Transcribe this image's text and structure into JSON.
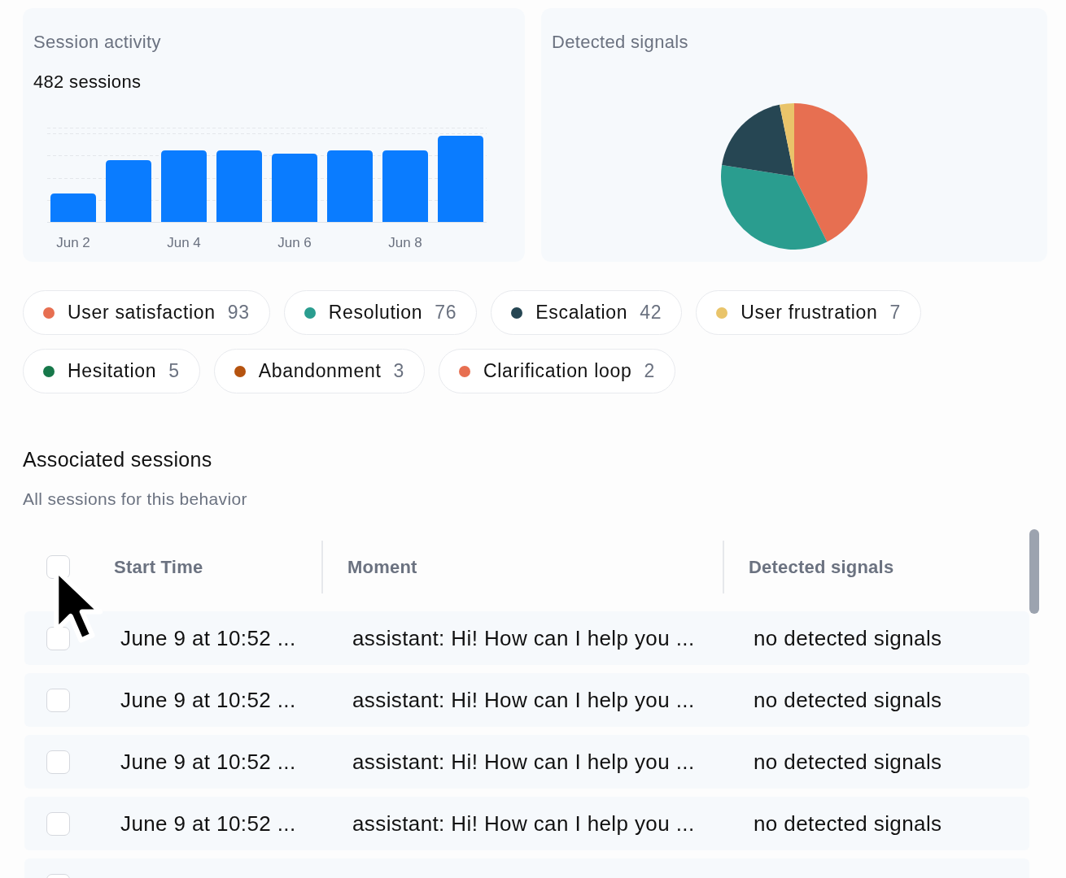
{
  "session_activity": {
    "title": "Session activity",
    "total": "482 sessions",
    "x_labels": [
      "Jun 2",
      "Jun 4",
      "Jun 6",
      "Jun 8"
    ]
  },
  "detected_signals": {
    "title": "Detected signals",
    "chart_data": {
      "type": "pie",
      "values": [
        42.6,
        34.9,
        19.3,
        3.2
      ]
    }
  },
  "signals": [
    {
      "label": "User satisfaction",
      "count": "93",
      "color": "#e76f51"
    },
    {
      "label": "Resolution",
      "count": "76",
      "color": "#2a9d8f"
    },
    {
      "label": "Escalation",
      "count": "42",
      "color": "#264653"
    },
    {
      "label": "User frustration",
      "count": "7",
      "color": "#e9c46a"
    },
    {
      "label": "Hesitation",
      "count": "5",
      "color": "#17784a"
    },
    {
      "label": "Abandonment",
      "count": "3",
      "color": "#b5530f"
    },
    {
      "label": "Clarification loop",
      "count": "2",
      "color": "#e76f51"
    }
  ],
  "associated_sessions": {
    "title": "Associated sessions",
    "subtitle": "All sessions for this behavior",
    "table": {
      "select_all": {
        "checked": false
      },
      "columns": [
        "Start Time",
        "Moment",
        "Detected signals"
      ],
      "rows": [
        {
          "checked": false,
          "start_time": "June 9 at 10:52 ...",
          "moment": "assistant: Hi! How can I help you ...",
          "detected_signals": "no detected signals"
        },
        {
          "checked": false,
          "start_time": "June 9 at 10:52 ...",
          "moment": "assistant: Hi! How can I help you ...",
          "detected_signals": "no detected signals"
        },
        {
          "checked": false,
          "start_time": "June 9 at 10:52 ...",
          "moment": "assistant: Hi! How can I help you ...",
          "detected_signals": "no detected signals"
        },
        {
          "checked": false,
          "start_time": "June 9 at 10:52 ...",
          "moment": "assistant: Hi! How can I help you ...",
          "detected_signals": "no detected signals"
        },
        {
          "checked": false
        }
      ]
    }
  }
}
